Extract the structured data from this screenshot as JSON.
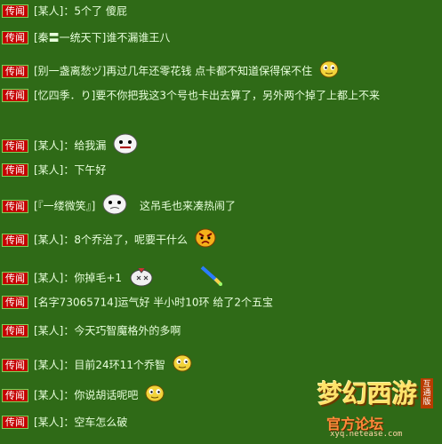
{
  "tag_label": "传闻",
  "messages": [
    {
      "text": "[某人]：5个了  傻屁"
    },
    {
      "text": "[秦〓一统天下]谁不漏谁王八"
    },
    {
      "text": "[别一盏离愁ヅ]再过几年还零花钱 点卡都不知道保得保不住"
    },
    {
      "text": "[忆四季．り]要不你把我这3个号也卡出去算了，另外两个掉了上都上不来"
    },
    {
      "text": "[某人]：给我漏"
    },
    {
      "text": "[某人]：下午好"
    },
    {
      "text": "[『一缕微笑』]",
      "text2": "这吊毛也来凑热闹了"
    },
    {
      "text": "[某人]：8个乔治了，呢要干什么"
    },
    {
      "text": "[某人]：你掉毛+1"
    },
    {
      "text": "[名字73065714]运气好  半小时10环 给了2个五宝"
    },
    {
      "text": "[某人]：今天巧智魔格外的多啊"
    },
    {
      "text": "[某人]：目前24环11个乔智"
    },
    {
      "text": "[某人]：你说胡话呢吧"
    },
    {
      "text": "[某人]：空车怎么破"
    }
  ],
  "logo": {
    "title": "梦幻西游",
    "badge": "互通版",
    "subtitle": "官方论坛",
    "url": "xyq.netease.com"
  },
  "icons": [
    "smiley-face-icon",
    "ghost-face-icon",
    "angry-face-icon",
    "pet-creature-icon",
    "sword-item-icon"
  ]
}
